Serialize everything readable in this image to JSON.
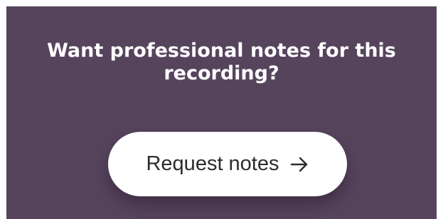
{
  "card": {
    "headline": "Want professional notes for this recording?",
    "background_color": "#56445d"
  },
  "cta": {
    "label": "Request notes",
    "icon": "arrow-right-icon"
  }
}
